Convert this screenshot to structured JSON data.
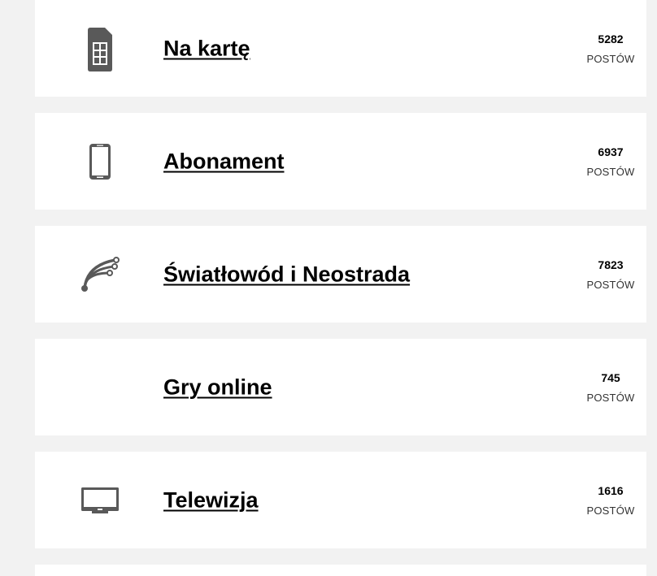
{
  "categories": [
    {
      "title": "Na kartę",
      "count": "5282",
      "unit": "POSTÓW",
      "icon": "sim-card-icon"
    },
    {
      "title": "Abonament",
      "count": "6937",
      "unit": "POSTÓW",
      "icon": "smartphone-icon"
    },
    {
      "title": "Światłowód i Neostrada",
      "count": "7823",
      "unit": "POSTÓW",
      "icon": "fiber-optic-icon"
    },
    {
      "title": "Gry online",
      "count": "745",
      "unit": "POSTÓW",
      "icon": ""
    },
    {
      "title": "Telewizja",
      "count": "1616",
      "unit": "POSTÓW",
      "icon": "tv-icon"
    }
  ],
  "colors": {
    "icon": "#595959",
    "background": "#f2f2f2",
    "card": "#ffffff"
  }
}
